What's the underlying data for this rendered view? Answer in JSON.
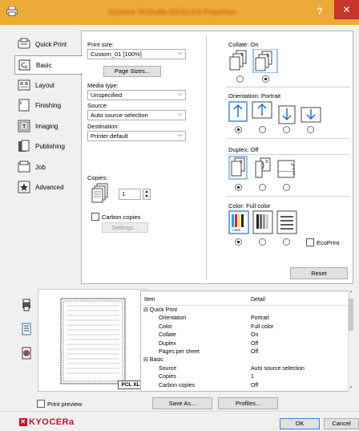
{
  "window": {
    "title": "Kyocera TASKalfa 4053ci KX Properties",
    "help": "?",
    "close": "✕"
  },
  "nav": {
    "items": [
      {
        "label": "Quick Print",
        "icon": "quick-print-icon"
      },
      {
        "label": "Basic",
        "icon": "basic-icon",
        "selected": true
      },
      {
        "label": "Layout",
        "icon": "layout-icon"
      },
      {
        "label": "Finishing",
        "icon": "finishing-icon"
      },
      {
        "label": "Imaging",
        "icon": "imaging-icon"
      },
      {
        "label": "Publishing",
        "icon": "publishing-icon"
      },
      {
        "label": "Job",
        "icon": "job-icon"
      },
      {
        "label": "Advanced",
        "icon": "advanced-icon"
      }
    ]
  },
  "basic": {
    "print_size_label": "Print size:",
    "print_size_value": "Custom_01 [100%]",
    "page_sizes_button": "Page Sizes...",
    "media_type_label": "Media type:",
    "media_type_value": "Unspecified",
    "source_label": "Source:",
    "source_value": "Auto source selection",
    "destination_label": "Destination:",
    "destination_value": "Printer default",
    "copies_label": "Copies:",
    "copies_value": "1",
    "carbon_copies_label": "Carbon copies",
    "settings_button": "Settings...",
    "collate_label": "Collate:  On",
    "orientation_label": "Orientation:  Portrait",
    "duplex_label": "Duplex:  Off",
    "color_label": "Color:  Full color",
    "ecoprint_label": "EcoPrint",
    "reset_button": "Reset"
  },
  "preview": {
    "badge": "PCL XL",
    "print_preview_label": "Print preview"
  },
  "summary": {
    "columns": [
      "Item",
      "Detail"
    ],
    "rows": [
      {
        "item": "⊟ Quick Print",
        "detail": "",
        "indent": 0
      },
      {
        "item": "Orientation",
        "detail": "Portrait",
        "indent": 1
      },
      {
        "item": "Color",
        "detail": "Full color",
        "indent": 1
      },
      {
        "item": "Collate",
        "detail": "On",
        "indent": 1
      },
      {
        "item": "Duplex",
        "detail": "Off",
        "indent": 1
      },
      {
        "item": "Pages per sheet",
        "detail": "Off",
        "indent": 1
      },
      {
        "item": "⊟ Basic",
        "detail": "",
        "indent": 0
      },
      {
        "item": "Source",
        "detail": "Auto source selection",
        "indent": 1
      },
      {
        "item": "Copies",
        "detail": "1",
        "indent": 1
      },
      {
        "item": "Carbon copies",
        "detail": "Off",
        "indent": 1
      }
    ]
  },
  "footer": {
    "save_as_button": "Save As...",
    "profiles_button": "Profiles...",
    "ok_button": "OK",
    "cancel_button": "Cancel",
    "logo": "KYOCERa"
  },
  "colors": {
    "titlebar": "#ecaa36",
    "close": "#c7362a",
    "accent": "#3a83d7",
    "logo": "#c7102e"
  }
}
